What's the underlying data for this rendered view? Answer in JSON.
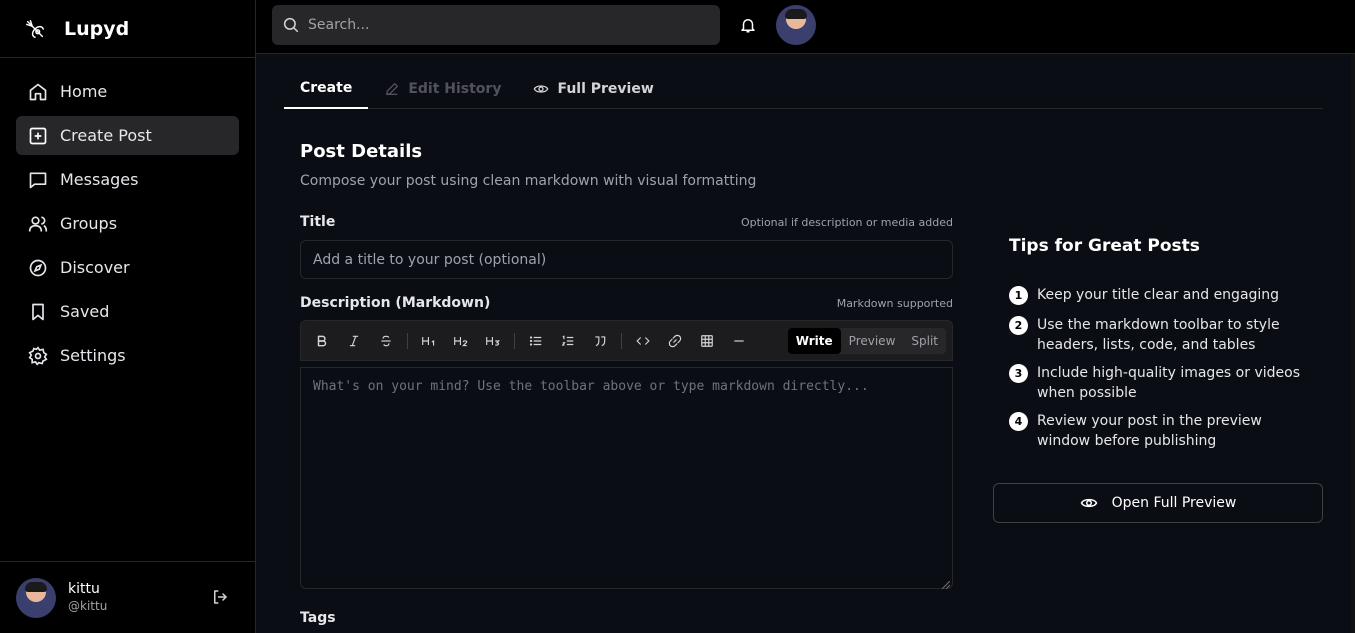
{
  "app": {
    "name": "Lupyd"
  },
  "sidebar": {
    "items": [
      {
        "label": "Home",
        "icon": "home-icon"
      },
      {
        "label": "Create Post",
        "icon": "plus-square-icon",
        "active": true
      },
      {
        "label": "Messages",
        "icon": "message-icon"
      },
      {
        "label": "Groups",
        "icon": "users-icon"
      },
      {
        "label": "Discover",
        "icon": "compass-icon"
      },
      {
        "label": "Saved",
        "icon": "bookmark-icon"
      },
      {
        "label": "Settings",
        "icon": "gear-icon"
      }
    ],
    "user": {
      "name": "kittu",
      "handle": "@kittu"
    }
  },
  "topbar": {
    "search_placeholder": "Search..."
  },
  "tabs": [
    {
      "label": "Create",
      "state": "active"
    },
    {
      "label": "Edit History",
      "state": "disabled"
    },
    {
      "label": "Full Preview",
      "state": "normal"
    }
  ],
  "form": {
    "title": "Post Details",
    "subtitle": "Compose your post using clean markdown with visual formatting",
    "title_label": "Title",
    "title_hint": "Optional if description or media added",
    "title_placeholder": "Add a title to your post (optional)",
    "description_label": "Description (Markdown)",
    "description_hint": "Markdown supported",
    "editor_placeholder": "What's on your mind? Use the toolbar above or type markdown directly...",
    "modes": [
      "Write",
      "Preview",
      "Split"
    ],
    "tags_label": "Tags"
  },
  "tips": {
    "title": "Tips for Great Posts",
    "items": [
      {
        "num": "1",
        "text": "Keep your title clear and engaging"
      },
      {
        "num": "2",
        "text": "Use the markdown toolbar to style headers, lists, code, and tables"
      },
      {
        "num": "3",
        "text": "Include high-quality images or videos when possible"
      },
      {
        "num": "4",
        "text": "Review your post in the preview window before publishing"
      }
    ],
    "preview_button": "Open Full Preview"
  }
}
